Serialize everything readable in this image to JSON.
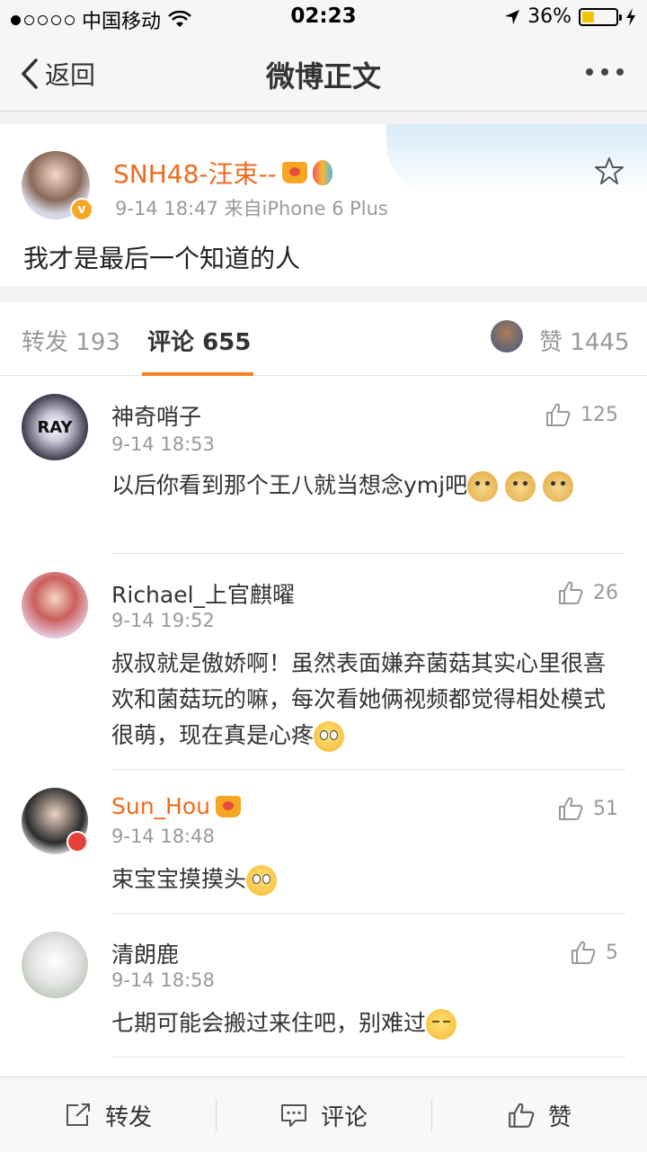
{
  "status_bar": {
    "carrier": "中国移动",
    "time": "02:23",
    "battery": "36%",
    "battery_level": 0.36
  },
  "nav": {
    "back_label": "返回",
    "title": "微博正文"
  },
  "post": {
    "author": "SNH48-汪束--",
    "meta": "9-14 18:47  来自iPhone 6 Plus",
    "text": "我才是最后一个知道的人",
    "verified_badge": "v"
  },
  "tabs": {
    "repost_label": "转发",
    "repost_count": "193",
    "comment_label": "评论",
    "comment_count": "655",
    "like_label": "赞",
    "like_count": "1445"
  },
  "comments": [
    {
      "name": "神奇哨子",
      "time": "9-14 18:53",
      "text": "以后你看到那个王八就当想念ymj吧",
      "likes": "125",
      "avatar_text": "RAY"
    },
    {
      "name": "Richael_上官麒曜",
      "time": "9-14 19:52",
      "text": "叔叔就是傲娇啊！虽然表面嫌弃菌菇其实心里很喜欢和菌菇玩的嘛，每次看她俩视频都觉得相处模式很萌，现在真是心疼",
      "likes": "26"
    },
    {
      "name": "Sun_Hou",
      "time": "9-14 18:48",
      "text": "束宝宝摸摸头",
      "likes": "51"
    },
    {
      "name": "清朗鹿",
      "time": "9-14 18:58",
      "text": "七期可能会搬过来住吧，别难过",
      "likes": "5"
    }
  ],
  "bottom_bar": {
    "repost": "转发",
    "comment": "评论",
    "like": "赞"
  },
  "colors": {
    "accent": "#f58220",
    "username_orange": "#f06a1b",
    "meta_gray": "#999999"
  }
}
